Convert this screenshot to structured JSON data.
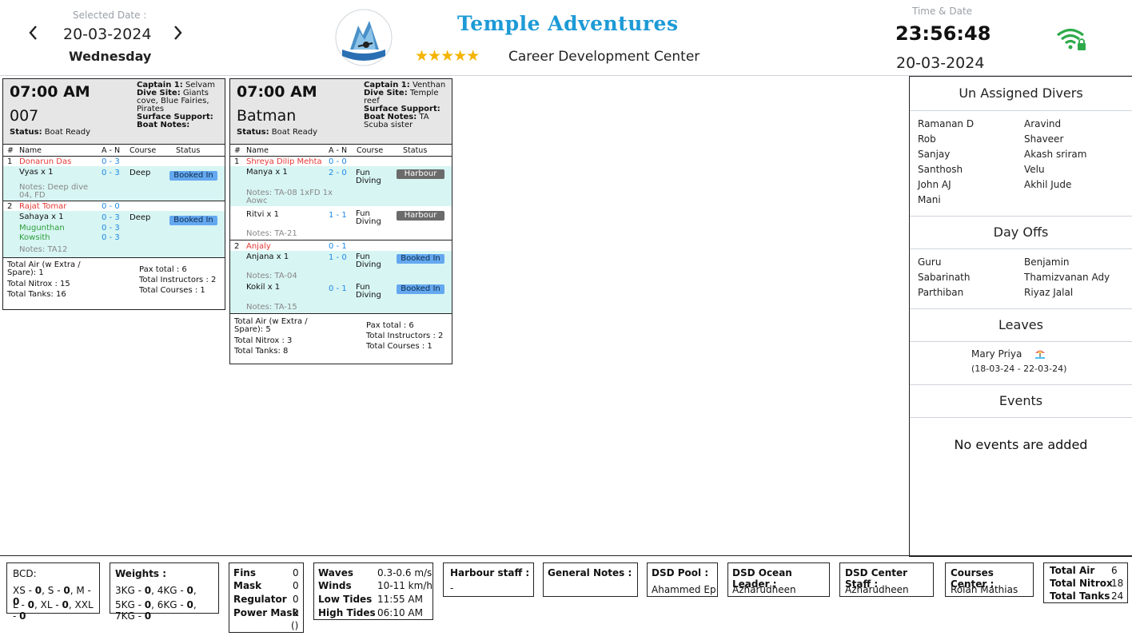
{
  "header": {
    "selected_date_label": "Selected Date :",
    "selected_date": "20-03-2024",
    "day": "Wednesday",
    "prev_icon": "chevron-left-icon",
    "next_icon": "chevron-right-icon",
    "brand_title": "Temple Adventures",
    "stars": "★★★★★",
    "subtitle": "Career Development Center",
    "time_date_label": "Time & Date",
    "clock": "23:56:48",
    "clock_date": "20-03-2024",
    "wifi_icon": "wifi-lock-icon"
  },
  "trips": [
    {
      "time": "07:00 AM",
      "boat": "007",
      "status_label": "Status:",
      "status": "Boat Ready",
      "captain_label": "Captain 1:",
      "captain": "Selvam",
      "dive_site_label": "Dive Site:",
      "dive_site": "Giants cove, Blue Fairies, Pirates",
      "surface_label": "Surface Support:",
      "surface": "",
      "boat_notes_label": "Boat Notes:",
      "boat_notes": "",
      "columns": [
        "#",
        "Name",
        "A - N",
        "Course",
        "Status"
      ],
      "groups": [
        {
          "num": "1",
          "lead": "Donarun Das",
          "lead_an": "0 - 3",
          "members": [
            {
              "name": "Vyas x 1",
              "an": "0 - 3",
              "course": "Deep",
              "status": "Booked In",
              "notes": "Notes: Deep dive 04, FD"
            }
          ]
        },
        {
          "num": "2",
          "lead": "Rajat Tomar",
          "lead_an": "0 - 0",
          "members": [
            {
              "name": "Sahaya x 1",
              "an": "0 - 3",
              "course": "Deep",
              "status": "Booked In"
            },
            {
              "name": "Mugunthan",
              "an": "0 - 3"
            },
            {
              "name": "Kowsith",
              "an": "0 - 3",
              "notes": "Notes: TA12"
            }
          ]
        }
      ],
      "totals": {
        "air": "Total Air (w Extra / Spare):  1",
        "nitrox": "Total Nitrox :  15",
        "tanks": "Total Tanks:  16",
        "pax": "Pax total :  6",
        "instructors": "Total Instructors :  2",
        "courses": "Total Courses :  1"
      }
    },
    {
      "time": "07:00 AM",
      "boat": "Batman",
      "status_label": "Status:",
      "status": "Boat Ready",
      "captain_label": "Captain 1:",
      "captain": "Venthan",
      "dive_site_label": "Dive Site:",
      "dive_site": "Temple reef",
      "surface_label": "Surface Support:",
      "surface": "",
      "boat_notes_label": "Boat Notes:",
      "boat_notes": "TA Scuba sister",
      "columns": [
        "#",
        "Name",
        "A - N",
        "Course",
        "Status"
      ],
      "groups": [
        {
          "num": "1",
          "lead": "Shreya Dilip Mehta",
          "lead_an": "0 - 0",
          "members": [
            {
              "name": "Manya x 1",
              "an": "2 - 0",
              "course": "Fun Diving",
              "status": "Harbour",
              "notes": "Notes: TA-08 1xFD 1x Aowc"
            },
            {
              "name": "Ritvi x 1",
              "an": "1 - 1",
              "course": "Fun Diving",
              "status": "Harbour",
              "notes": "Notes: TA-21"
            }
          ]
        },
        {
          "num": "2",
          "lead": "Anjaly",
          "lead_an": "0 - 1",
          "members": [
            {
              "name": "Anjana x 1",
              "an": "1 - 0",
              "course": "Fun Diving",
              "status": "Booked In",
              "notes": "Notes: TA-04"
            },
            {
              "name": "Kokil x 1",
              "an": "0 - 1",
              "course": "Fun Diving",
              "status": "Booked In",
              "notes": "Notes: TA-15"
            }
          ]
        }
      ],
      "totals": {
        "air": "Total Air (w Extra / Spare):  5",
        "nitrox": "Total Nitrox :  3",
        "tanks": "Total Tanks:  8",
        "pax": "Pax total :  6",
        "instructors": "Total Instructors :  2",
        "courses": "Total Courses :  1"
      }
    }
  ],
  "right_panel": {
    "unassigned_title": "Un Assigned Divers",
    "unassigned": [
      "Ramanan D",
      "Aravind",
      "Rob",
      "Shaveer",
      "Sanjay",
      "Akash  sriram",
      "Santhosh",
      "Velu",
      "John AJ",
      "Akhil Jude",
      "Mani"
    ],
    "dayoffs_title": "Day Offs",
    "dayoffs": [
      "Guru",
      "Benjamin",
      "Sabarinath",
      "Thamizvanan  Ady",
      "Parthiban",
      "Riyaz Jalal"
    ],
    "leaves_title": "Leaves",
    "leave_name": "Mary Priya",
    "leave_icon": "beach-umbrella-icon",
    "leave_dates": "(18-03-24 - 22-03-24)",
    "events_title": "Events",
    "events_empty": "No events are added"
  },
  "bottom": {
    "bcd_title": "BCD:",
    "bcd_line1": [
      [
        "XS - ",
        "0"
      ],
      [
        ", S - ",
        "0"
      ],
      [
        ", M - ",
        "0"
      ]
    ],
    "bcd_line2": [
      [
        "L - ",
        "0"
      ],
      [
        ", XL - ",
        "0"
      ],
      [
        ", XXL - ",
        "0"
      ]
    ],
    "weights_title": "Weights :",
    "weights_line1": [
      [
        "3KG - ",
        "0"
      ],
      [
        ", 4KG - ",
        "0"
      ],
      [
        ",",
        ""
      ]
    ],
    "weights_line2": [
      [
        "5KG - ",
        "0"
      ],
      [
        ", 6KG - ",
        "0"
      ],
      [
        ", 7KG - ",
        "0"
      ]
    ],
    "gear": [
      {
        "label": "Fins",
        "value": "0"
      },
      {
        "label": "Mask",
        "value": "0"
      },
      {
        "label": "Regulator",
        "value": "0"
      },
      {
        "label": "Power Mask",
        "value": "0"
      }
    ],
    "gear_extra": "()",
    "conditions": [
      {
        "label": "Waves",
        "value": "0.3-0.6 m/s"
      },
      {
        "label": "Winds",
        "value": "10-11 km/h"
      },
      {
        "label": "Low Tides",
        "value": "11:55 AM"
      },
      {
        "label": "High Tides",
        "value": "06:10 AM"
      }
    ],
    "harbour_title": "Harbour staff :",
    "harbour_value": "-",
    "general_title": "General Notes :",
    "dsd_pool_title": "DSD Pool :",
    "dsd_pool_value": "Ahammed Ep",
    "dsd_ocean_title": "DSD Ocean Leader :",
    "dsd_ocean_value": "Azharudheen",
    "dsd_center_title": "DSD Center Staff :",
    "dsd_center_value": "Azharudheen",
    "courses_center_title": "Courses Center :",
    "courses_center_value": "Rolan Mathias",
    "totals": [
      {
        "label": "Total Air",
        "value": "6"
      },
      {
        "label": "Total Nitrox",
        "value": "18"
      },
      {
        "label": "Total Tanks",
        "value": "24"
      }
    ]
  }
}
